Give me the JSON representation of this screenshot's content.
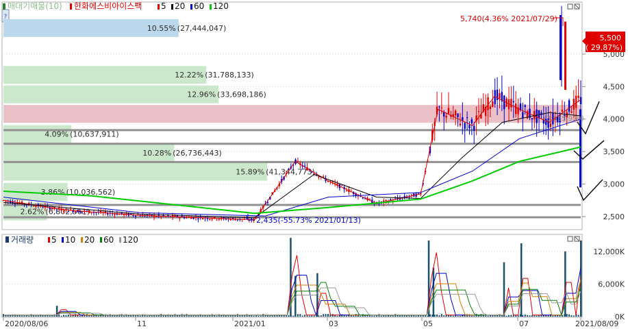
{
  "price_panel": {
    "legend_prefix": "매대기매물(10)",
    "stock_name": "한화에스비아이스팩",
    "ma_legend": [
      {
        "label": "5",
        "color": "#e00000"
      },
      {
        "label": "20",
        "color": "#000000"
      },
      {
        "label": "60",
        "color": "#0000cc"
      },
      {
        "label": "120",
        "color": "#00cc00"
      }
    ],
    "high_annotation": "5,740(4.36% 2021/07/29)",
    "low_annotation": "2,435(-55.73% 2021/01/13)",
    "current_price": "5,500",
    "current_change": "( 29.87%)",
    "y_ticks": [
      "5,000",
      "4,500",
      "4,000",
      "3,500",
      "3,000",
      "2,500"
    ],
    "resistance_annotation": "(3,935,929)",
    "side_icon": "?"
  },
  "volume_panel": {
    "legend_title": "거래량",
    "ma_legend": [
      {
        "label": "5",
        "color": "#e00000"
      },
      {
        "label": "10",
        "color": "#0000cc"
      },
      {
        "label": "20",
        "color": "#d08000"
      },
      {
        "label": "60",
        "color": "#008000"
      },
      {
        "label": "120",
        "color": "#999999"
      }
    ],
    "y_ticks": [
      "12,000K",
      "6,000K",
      "0K"
    ]
  },
  "x_axis": {
    "labels": [
      "2020/08/06",
      "11",
      "2021/01",
      "03",
      "05",
      "07",
      "2021/08/09"
    ]
  },
  "chart_data": [
    {
      "type": "bar",
      "title": "매대기매물(10)",
      "orientation": "horizontal",
      "rows": [
        {
          "pct": "10.55%",
          "amount": "27,444,047",
          "price": 5400
        },
        {
          "pct": "12.22%",
          "amount": "31,788,133",
          "price": 4680
        },
        {
          "pct": "12.96%",
          "amount": "33,698,186",
          "price": 4380
        },
        {
          "pct": "",
          "amount": "",
          "price": 4080,
          "highlight": true
        },
        {
          "pct": "4.09%",
          "amount": "10,637,911",
          "price": 3770
        },
        {
          "pct": "10.28%",
          "amount": "26,736,443",
          "price": 3480
        },
        {
          "pct": "15.89%",
          "amount": "41,344,773",
          "price": 3190
        },
        {
          "pct": "3.86%",
          "amount": "10,036,562",
          "price": 2880
        },
        {
          "pct": "2.62%",
          "amount": "6,802,561",
          "price": 2580
        }
      ]
    },
    {
      "type": "line",
      "title": "한화에스비아이스팩",
      "ylim": [
        2300,
        5800
      ],
      "xlim": [
        "2020/08/06",
        "2021/08/09"
      ],
      "series": [
        {
          "name": "5",
          "color": "#e00000",
          "points": [
            [
              "2020/08/06",
              2750
            ],
            [
              "2020/09/15",
              2600
            ],
            [
              "2020/11/01",
              2520
            ],
            [
              "2021/01/13",
              2450
            ],
            [
              "2021/02/08",
              3350
            ],
            [
              "2021/03/01",
              3050
            ],
            [
              "2021/04/01",
              2700
            ],
            [
              "2021/04/29",
              2850
            ],
            [
              "2021/05/10",
              4150
            ],
            [
              "2021/06/01",
              3900
            ],
            [
              "2021/06/15",
              4350
            ],
            [
              "2021/07/01",
              4150
            ],
            [
              "2021/07/20",
              3950
            ],
            [
              "2021/08/09",
              4300
            ]
          ]
        },
        {
          "name": "20",
          "color": "#000000",
          "points": [
            [
              "2020/08/06",
              2720
            ],
            [
              "2020/11/01",
              2540
            ],
            [
              "2021/01/13",
              2480
            ],
            [
              "2021/02/20",
              3150
            ],
            [
              "2021/04/01",
              2800
            ],
            [
              "2021/04/29",
              2780
            ],
            [
              "2021/05/25",
              3400
            ],
            [
              "2021/06/20",
              3950
            ],
            [
              "2021/07/20",
              4100
            ],
            [
              "2021/08/09",
              4050
            ]
          ]
        },
        {
          "name": "60",
          "color": "#0000cc",
          "points": [
            [
              "2020/08/06",
              2800
            ],
            [
              "2020/11/01",
              2560
            ],
            [
              "2021/01/20",
              2510
            ],
            [
              "2021/03/01",
              2800
            ],
            [
              "2021/04/29",
              2870
            ],
            [
              "2021/06/01",
              3200
            ],
            [
              "2021/07/01",
              3700
            ],
            [
              "2021/08/09",
              4000
            ]
          ]
        },
        {
          "name": "120",
          "color": "#00cc00",
          "points": [
            [
              "2020/08/06",
              2890
            ],
            [
              "2020/10/01",
              2820
            ],
            [
              "2021/01/13",
              2550
            ],
            [
              "2021/03/01",
              2640
            ],
            [
              "2021/04/29",
              2770
            ],
            [
              "2021/06/01",
              3050
            ],
            [
              "2021/07/01",
              3350
            ],
            [
              "2021/08/09",
              3570
            ]
          ]
        }
      ]
    },
    {
      "type": "bar",
      "title": "거래량",
      "ylim": [
        0,
        15000
      ],
      "volume_spikes": [
        {
          "x": "2020/09/09",
          "volume": 2000
        },
        {
          "x": "2021/02/05",
          "volume": 14500
        },
        {
          "x": "2021/02/08",
          "volume": 7500
        },
        {
          "x": "2021/02/22",
          "volume": 8000
        },
        {
          "x": "2021/05/04",
          "volume": 14000
        },
        {
          "x": "2021/05/07",
          "volume": 9000
        },
        {
          "x": "2021/06/21",
          "volume": 10000
        },
        {
          "x": "2021/07/02",
          "volume": 13500
        },
        {
          "x": "2021/07/30",
          "volume": 12000
        },
        {
          "x": "2021/08/09",
          "volume": 14000
        }
      ]
    }
  ]
}
